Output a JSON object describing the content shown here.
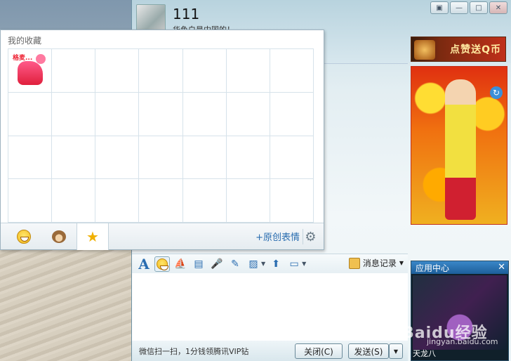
{
  "chat": {
    "contact_name": "111",
    "signature": "华鱼白是中国的！",
    "window_buttons": {
      "skin": "▣",
      "minimize": "—",
      "maximize": "□",
      "close": "✕"
    }
  },
  "ads": {
    "banner_text": "点赞送Q币"
  },
  "toolbar": {
    "font_label": "A",
    "history_label": "消息记录"
  },
  "footer": {
    "tip": "微信扫一扫，1分钱领腾讯VIP钻",
    "close_button": "关闭(C)",
    "send_button": "发送(S)"
  },
  "app_center": {
    "title": "应用中心",
    "caption": "天龙八"
  },
  "favorites": {
    "title": "我的收藏",
    "sticker_text": "格麦...",
    "create_label": "+原创表情"
  },
  "watermark": {
    "text": "Baidu经验",
    "url": "jingyan.baidu.com"
  }
}
